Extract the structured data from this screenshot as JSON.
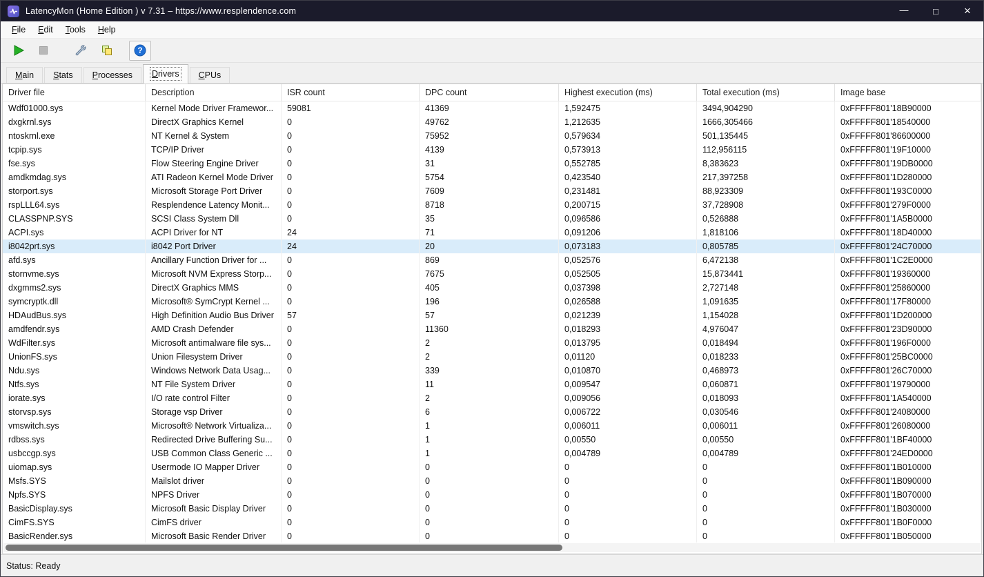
{
  "window": {
    "title": "LatencyMon  (Home Edition )  v 7.31 – https://www.resplendence.com",
    "controls": {
      "minimize": "—",
      "maximize": "□",
      "close": "×"
    }
  },
  "menu_bar": {
    "items": [
      {
        "label": "File"
      },
      {
        "label": "Edit"
      },
      {
        "label": "Tools"
      },
      {
        "label": "Help"
      }
    ]
  },
  "toolbar": {
    "buttons": [
      {
        "name": "start-monitor",
        "icon": "play-icon",
        "enabled": true
      },
      {
        "name": "stop-monitor",
        "icon": "stop-icon",
        "enabled": false
      },
      {
        "name": "tools-options",
        "icon": "wrench-icon",
        "enabled": true
      },
      {
        "name": "copy-report",
        "icon": "copy-icon",
        "enabled": true
      },
      {
        "name": "help",
        "icon": "help-icon",
        "enabled": true
      }
    ]
  },
  "tabs": {
    "items": [
      {
        "label": "Main",
        "active": false
      },
      {
        "label": "Stats",
        "active": false
      },
      {
        "label": "Processes",
        "active": false
      },
      {
        "label": "Drivers",
        "active": true
      },
      {
        "label": "CPUs",
        "active": false
      }
    ]
  },
  "drivers_table": {
    "columns": [
      "Driver file",
      "Description",
      "ISR count",
      "DPC count",
      "Highest execution (ms)",
      "Total execution (ms)",
      "Image base"
    ],
    "selected_row_index": 10,
    "rows": [
      [
        "Wdf01000.sys",
        "Kernel Mode Driver Framewor...",
        "59081",
        "41369",
        "1,592475",
        "3494,904290",
        "0xFFFFF801'18B90000"
      ],
      [
        "dxgkrnl.sys",
        "DirectX Graphics Kernel",
        "0",
        "49762",
        "1,212635",
        "1666,305466",
        "0xFFFFF801'18540000"
      ],
      [
        "ntoskrnl.exe",
        "NT Kernel & System",
        "0",
        "75952",
        "0,579634",
        "501,135445",
        "0xFFFFF801'86600000"
      ],
      [
        "tcpip.sys",
        "TCP/IP Driver",
        "0",
        "4139",
        "0,573913",
        "112,956115",
        "0xFFFFF801'19F10000"
      ],
      [
        "fse.sys",
        "Flow Steering Engine Driver",
        "0",
        "31",
        "0,552785",
        "8,383623",
        "0xFFFFF801'19DB0000"
      ],
      [
        "amdkmdag.sys",
        "ATI Radeon Kernel Mode Driver",
        "0",
        "5754",
        "0,423540",
        "217,397258",
        "0xFFFFF801'1D280000"
      ],
      [
        "storport.sys",
        "Microsoft Storage Port Driver",
        "0",
        "7609",
        "0,231481",
        "88,923309",
        "0xFFFFF801'193C0000"
      ],
      [
        "rspLLL64.sys",
        "Resplendence Latency Monit...",
        "0",
        "8718",
        "0,200715",
        "37,728908",
        "0xFFFFF801'279F0000"
      ],
      [
        "CLASSPNP.SYS",
        "SCSI Class System Dll",
        "0",
        "35",
        "0,096586",
        "0,526888",
        "0xFFFFF801'1A5B0000"
      ],
      [
        "ACPI.sys",
        "ACPI Driver for NT",
        "24",
        "71",
        "0,091206",
        "1,818106",
        "0xFFFFF801'18D40000"
      ],
      [
        "i8042prt.sys",
        "i8042 Port Driver",
        "24",
        "20",
        "0,073183",
        "0,805785",
        "0xFFFFF801'24C70000"
      ],
      [
        "afd.sys",
        "Ancillary Function Driver for ...",
        "0",
        "869",
        "0,052576",
        "6,472138",
        "0xFFFFF801'1C2E0000"
      ],
      [
        "stornvme.sys",
        "Microsoft NVM Express Storp...",
        "0",
        "7675",
        "0,052505",
        "15,873441",
        "0xFFFFF801'19360000"
      ],
      [
        "dxgmms2.sys",
        "DirectX Graphics MMS",
        "0",
        "405",
        "0,037398",
        "2,727148",
        "0xFFFFF801'25860000"
      ],
      [
        "symcryptk.dll",
        "Microsoft® SymCrypt Kernel ...",
        "0",
        "196",
        "0,026588",
        "1,091635",
        "0xFFFFF801'17F80000"
      ],
      [
        "HDAudBus.sys",
        "High Definition Audio Bus Driver",
        "57",
        "57",
        "0,021239",
        "1,154028",
        "0xFFFFF801'1D200000"
      ],
      [
        "amdfendr.sys",
        "AMD Crash Defender",
        "0",
        "11360",
        "0,018293",
        "4,976047",
        "0xFFFFF801'23D90000"
      ],
      [
        "WdFilter.sys",
        "Microsoft antimalware file sys...",
        "0",
        "2",
        "0,013795",
        "0,018494",
        "0xFFFFF801'196F0000"
      ],
      [
        "UnionFS.sys",
        "Union Filesystem Driver",
        "0",
        "2",
        "0,01120",
        "0,018233",
        "0xFFFFF801'25BC0000"
      ],
      [
        "Ndu.sys",
        "Windows Network Data Usag...",
        "0",
        "339",
        "0,010870",
        "0,468973",
        "0xFFFFF801'26C70000"
      ],
      [
        "Ntfs.sys",
        "NT File System Driver",
        "0",
        "11",
        "0,009547",
        "0,060871",
        "0xFFFFF801'19790000"
      ],
      [
        "iorate.sys",
        "I/O rate control Filter",
        "0",
        "2",
        "0,009056",
        "0,018093",
        "0xFFFFF801'1A540000"
      ],
      [
        "storvsp.sys",
        "Storage vsp Driver",
        "0",
        "6",
        "0,006722",
        "0,030546",
        "0xFFFFF801'24080000"
      ],
      [
        "vmswitch.sys",
        "Microsoft® Network Virtualiza...",
        "0",
        "1",
        "0,006011",
        "0,006011",
        "0xFFFFF801'26080000"
      ],
      [
        "rdbss.sys",
        "Redirected Drive Buffering Su...",
        "0",
        "1",
        "0,00550",
        "0,00550",
        "0xFFFFF801'1BF40000"
      ],
      [
        "usbccgp.sys",
        "USB Common Class Generic ...",
        "0",
        "1",
        "0,004789",
        "0,004789",
        "0xFFFFF801'24ED0000"
      ],
      [
        "uiomap.sys",
        "Usermode IO Mapper Driver",
        "0",
        "0",
        "0",
        "0",
        "0xFFFFF801'1B010000"
      ],
      [
        "Msfs.SYS",
        "Mailslot driver",
        "0",
        "0",
        "0",
        "0",
        "0xFFFFF801'1B090000"
      ],
      [
        "Npfs.SYS",
        "NPFS Driver",
        "0",
        "0",
        "0",
        "0",
        "0xFFFFF801'1B070000"
      ],
      [
        "BasicDisplay.sys",
        "Microsoft Basic Display Driver",
        "0",
        "0",
        "0",
        "0",
        "0xFFFFF801'1B030000"
      ],
      [
        "CimFS.SYS",
        "CimFS driver",
        "0",
        "0",
        "0",
        "0",
        "0xFFFFF801'1B0F0000"
      ],
      [
        "BasicRender.sys",
        "Microsoft Basic Render Driver",
        "0",
        "0",
        "0",
        "0",
        "0xFFFFF801'1B050000"
      ]
    ]
  },
  "scrollbar": {
    "orientation": "horizontal",
    "thumb_percent": 57
  },
  "status_bar": {
    "text": "Status: Ready"
  }
}
